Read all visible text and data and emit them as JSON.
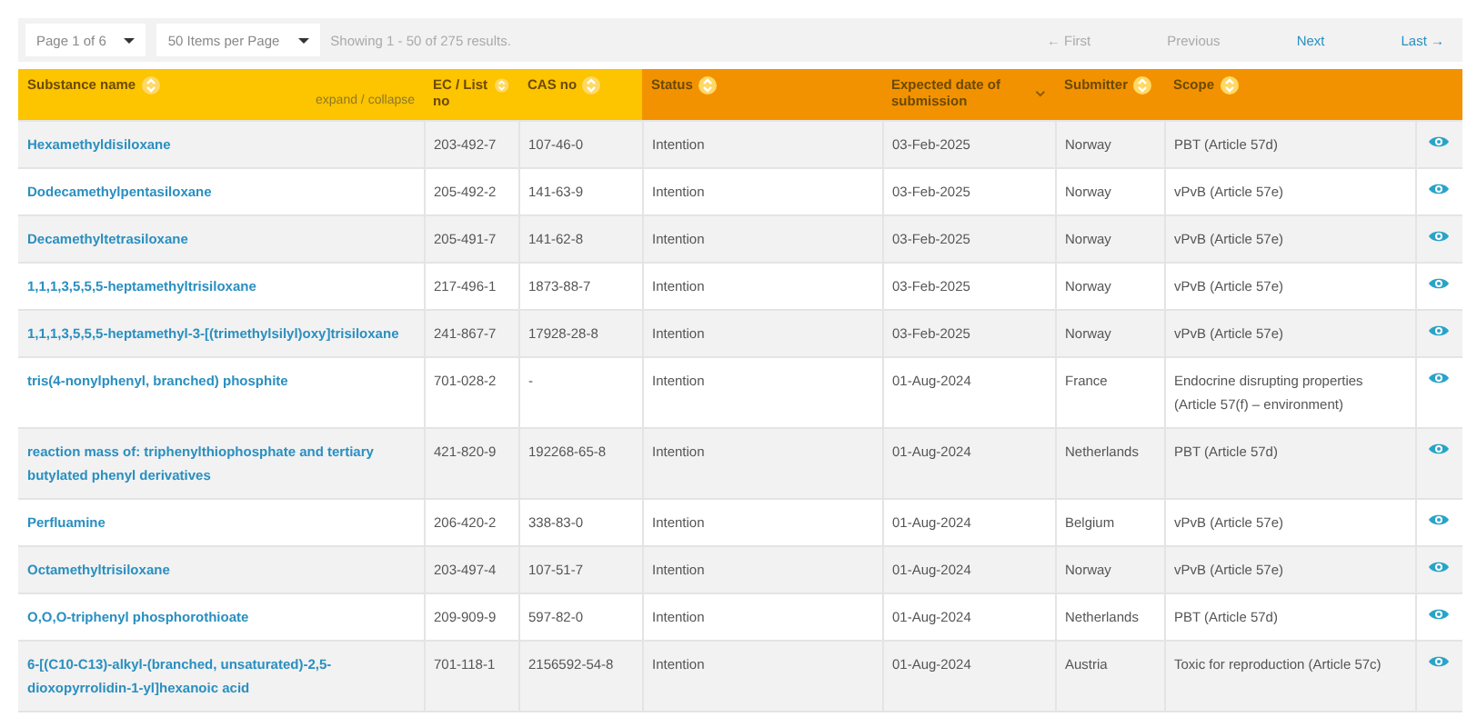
{
  "pager": {
    "page_select": "Page 1 of 6",
    "per_page_select": "50 Items per Page",
    "summary": "Showing 1 - 50 of 275 results.",
    "links": [
      {
        "label": "← First",
        "disabled": true
      },
      {
        "label": "Previous",
        "disabled": true
      },
      {
        "label": "Next",
        "disabled": false
      },
      {
        "label": "Last →",
        "disabled": false
      }
    ]
  },
  "table": {
    "expand_link": "expand / collapse",
    "columns": [
      {
        "label": "Substance name",
        "sorted": false,
        "accent": false
      },
      {
        "label": "EC / List no",
        "sorted": false,
        "accent": false
      },
      {
        "label": "CAS no",
        "sorted": false,
        "accent": false
      },
      {
        "label": "Status",
        "sorted": false,
        "accent": true
      },
      {
        "label": "Expected date of submission",
        "sorted": true,
        "accent": true
      },
      {
        "label": "Submitter",
        "sorted": false,
        "accent": true
      },
      {
        "label": "Scope",
        "sorted": false,
        "accent": true
      }
    ],
    "rows": [
      {
        "name": "Hexamethyldisiloxane",
        "ec": "203-492-7",
        "cas": "107-46-0",
        "status": "Intention",
        "date": "03-Feb-2025",
        "submitter": "Norway",
        "scope": "PBT (Article 57d)"
      },
      {
        "name": "Dodecamethylpentasiloxane",
        "ec": "205-492-2",
        "cas": "141-63-9",
        "status": "Intention",
        "date": "03-Feb-2025",
        "submitter": "Norway",
        "scope": "vPvB (Article 57e)"
      },
      {
        "name": "Decamethyltetrasiloxane",
        "ec": "205-491-7",
        "cas": "141-62-8",
        "status": "Intention",
        "date": "03-Feb-2025",
        "submitter": "Norway",
        "scope": "vPvB (Article 57e)"
      },
      {
        "name": "1,1,1,3,5,5,5-heptamethyltrisiloxane",
        "ec": "217-496-1",
        "cas": "1873-88-7",
        "status": "Intention",
        "date": "03-Feb-2025",
        "submitter": "Norway",
        "scope": "vPvB (Article 57e)"
      },
      {
        "name": "1,1,1,3,5,5,5-heptamethyl-3-[(trimethylsilyl)oxy]trisiloxane",
        "ec": "241-867-7",
        "cas": "17928-28-8",
        "status": "Intention",
        "date": "03-Feb-2025",
        "submitter": "Norway",
        "scope": "vPvB (Article 57e)"
      },
      {
        "name": "tris(4-nonylphenyl, branched) phosphite",
        "ec": "701-028-2",
        "cas": "-",
        "status": "Intention",
        "date": "01-Aug-2024",
        "submitter": "France",
        "scope": "Endocrine disrupting properties (Article 57(f) – environment)"
      },
      {
        "name": "reaction mass of: triphenylthiophosphate and tertiary butylated phenyl derivatives",
        "ec": "421-820-9",
        "cas": "192268-65-8",
        "status": "Intention",
        "date": "01-Aug-2024",
        "submitter": "Netherlands",
        "scope": "PBT (Article 57d)"
      },
      {
        "name": "Perfluamine",
        "ec": "206-420-2",
        "cas": "338-83-0",
        "status": "Intention",
        "date": "01-Aug-2024",
        "submitter": "Belgium",
        "scope": "vPvB (Article 57e)"
      },
      {
        "name": "Octamethyltrisiloxane",
        "ec": "203-497-4",
        "cas": "107-51-7",
        "status": "Intention",
        "date": "01-Aug-2024",
        "submitter": "Norway",
        "scope": "vPvB (Article 57e)"
      },
      {
        "name": "O,O,O-triphenyl phosphorothioate",
        "ec": "209-909-9",
        "cas": "597-82-0",
        "status": "Intention",
        "date": "01-Aug-2024",
        "submitter": "Netherlands",
        "scope": "PBT (Article 57d)"
      },
      {
        "name": "6-[(C10-C13)-alkyl-(branched, unsaturated)-2,5-dioxopyrrolidin-1-yl]hexanoic acid",
        "ec": "701-118-1",
        "cas": "2156592-54-8",
        "status": "Intention",
        "date": "01-Aug-2024",
        "submitter": "Austria",
        "scope": "Toxic for reproduction (Article 57c)"
      }
    ]
  }
}
